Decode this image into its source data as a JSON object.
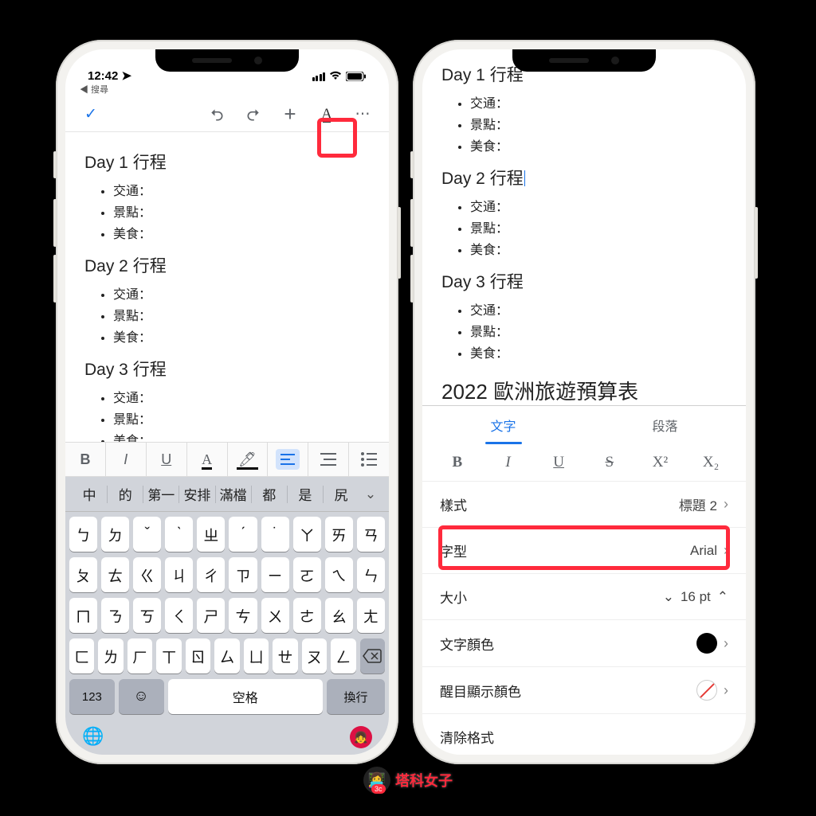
{
  "status": {
    "time": "12:42",
    "back_label": "◀ 搜尋"
  },
  "toolbar": {
    "check": "✓",
    "undo": "↶",
    "redo": "↷",
    "add": "+",
    "format": "A",
    "more": "⋯"
  },
  "doc": {
    "day1_title": "Day 1 行程",
    "day2_title": "Day 2 行程",
    "day3_title": "Day 3 行程",
    "items": [
      "交通：",
      "景點：",
      "美食："
    ],
    "budget_title": "2022 歐洲旅遊預算表"
  },
  "mini_fmt": {
    "bold": "B",
    "italic": "I",
    "underline": "U",
    "text_color": "A",
    "highlight": "✎",
    "align_left": "≡",
    "align_justify": "≣",
    "list": "≡"
  },
  "suggest": [
    "中",
    "的",
    "第一",
    "安排",
    "滿檔",
    "都",
    "是",
    "尻"
  ],
  "suggest_chev": "⌄",
  "keyboard": {
    "row1": [
      "ㄅ",
      "ㄉ",
      "ˇ",
      "ˋ",
      "ㄓ",
      "ˊ",
      "˙",
      "ㄚ",
      "ㄞ",
      "ㄢ"
    ],
    "row2": [
      "ㄆ",
      "ㄊ",
      "ㄍ",
      "ㄐ",
      "ㄔ",
      "ㄗ",
      "ㄧ",
      "ㄛ",
      "ㄟ",
      "ㄣ"
    ],
    "row3": [
      "ㄇ",
      "ㄋ",
      "ㄎ",
      "ㄑ",
      "ㄕ",
      "ㄘ",
      "ㄨ",
      "ㄜ",
      "ㄠ",
      "ㄤ"
    ],
    "row4": [
      "ㄈ",
      "ㄌ",
      "ㄏ",
      "ㄒ",
      "ㄖ",
      "ㄙ",
      "ㄩ",
      "ㄝ",
      "ㄡ",
      "ㄥ"
    ],
    "k123": "123",
    "emoji": "☺",
    "space": "空格",
    "enter": "換行",
    "del": "⌫"
  },
  "tabs": {
    "text": "文字",
    "paragraph": "段落"
  },
  "panel": {
    "fmt": {
      "bold": "B",
      "italic": "I",
      "underline": "U",
      "strike": "S",
      "sup": "X²",
      "sub": "X₂"
    },
    "style_label": "樣式",
    "style_value": "標題 2",
    "font_label": "字型",
    "font_value": "Arial",
    "size_label": "大小",
    "size_value": "16 pt",
    "color_label": "文字顏色",
    "hl_label": "醒目顯示顏色",
    "clear_label": "清除格式"
  },
  "brand": "塔科女子"
}
